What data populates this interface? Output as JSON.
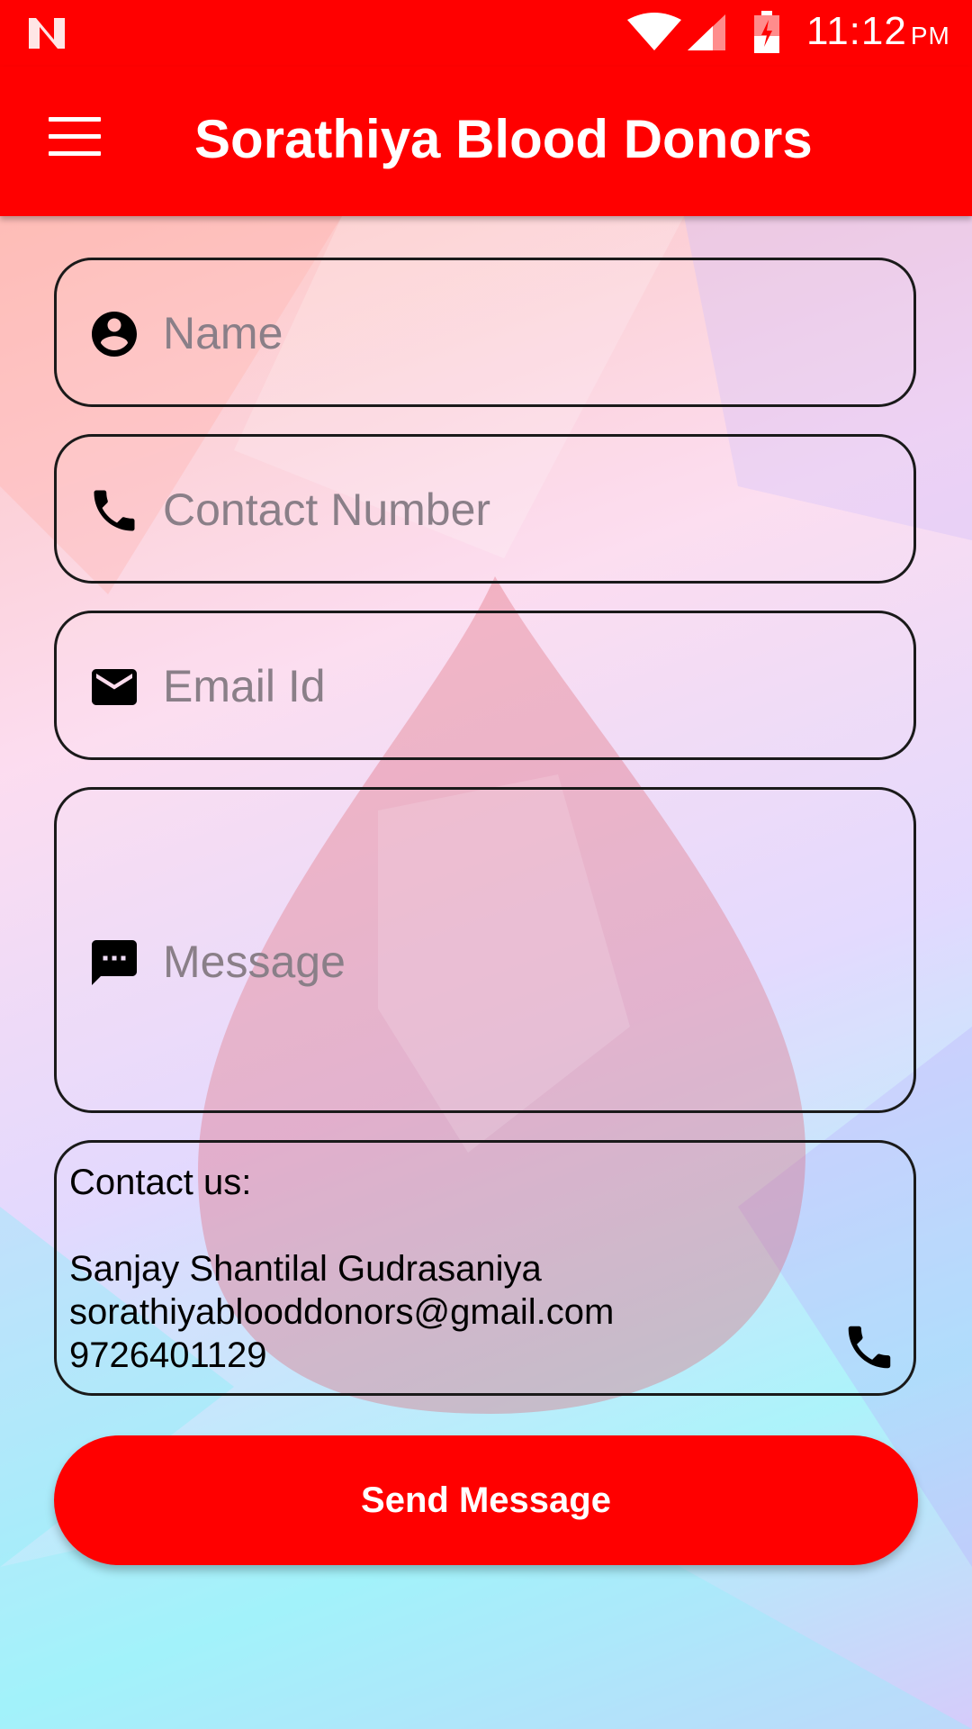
{
  "status_bar": {
    "time": "11:12",
    "ampm": "PM",
    "icons": [
      "notification-n-icon",
      "wifi-icon",
      "cell-signal-icon",
      "battery-charging-icon"
    ]
  },
  "app_bar": {
    "title": "Sorathiya Blood Donors",
    "menu_icon": "hamburger-menu-icon"
  },
  "form": {
    "name": {
      "placeholder": "Name",
      "value": "",
      "icon": "account-circle-icon"
    },
    "contact": {
      "placeholder": "Contact Number",
      "value": "",
      "icon": "phone-icon"
    },
    "email": {
      "placeholder": "Email Id",
      "value": "",
      "icon": "email-icon"
    },
    "message": {
      "placeholder": "Message",
      "value": "",
      "icon": "message-icon"
    }
  },
  "contact_info": {
    "heading": "Contact us:",
    "person": "Sanjay Shantilal Gudrasaniya",
    "email": "sorathiyablooddonors@gmail.com",
    "phone": "9726401129",
    "call_icon": "phone-icon"
  },
  "send_button": {
    "label": "Send Message"
  },
  "colors": {
    "primary": "#ff0000",
    "text": "#000000",
    "placeholder": "#8a7f88"
  }
}
